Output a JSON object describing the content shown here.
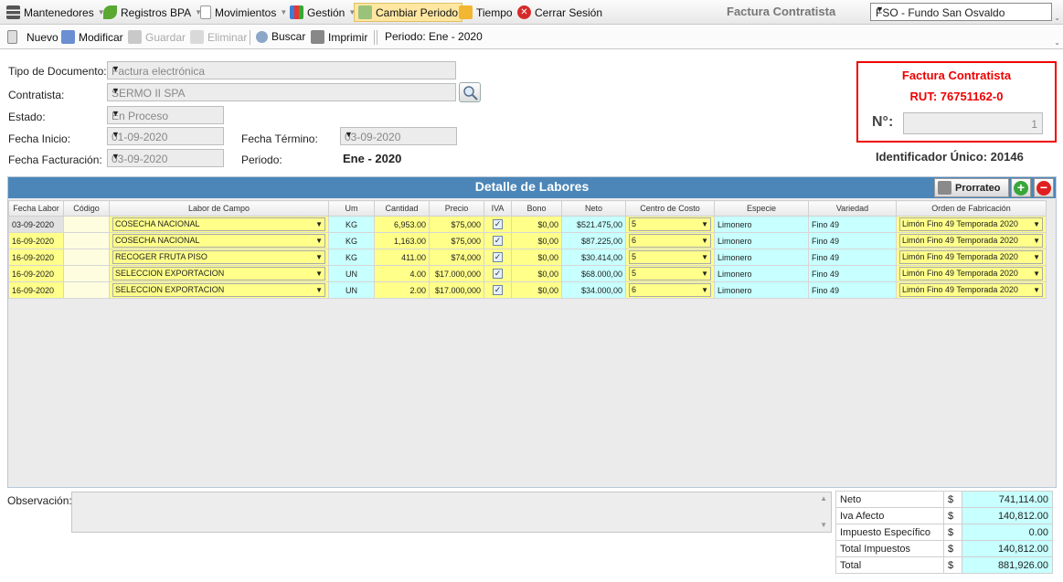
{
  "menu": {
    "items": [
      {
        "label": "Mantenedores",
        "icon": "table-icon"
      },
      {
        "label": "Registros BPA",
        "icon": "leaf-icon"
      },
      {
        "label": "Movimientos",
        "icon": "document-icon"
      },
      {
        "label": "Gestión",
        "icon": "chart-icon"
      },
      {
        "label": "Cambiar Periodo",
        "icon": "calendar-refresh-icon"
      },
      {
        "label": "Tiempo",
        "icon": "clock-icon"
      },
      {
        "label": "Cerrar Sesión",
        "icon": "close-circle-icon"
      }
    ],
    "title": "Factura Contratista",
    "fundo": "FSO - Fundo San Osvaldo"
  },
  "toolbar": {
    "nuevo": "Nuevo",
    "modificar": "Modificar",
    "guardar": "Guardar",
    "eliminar": "Eliminar",
    "buscar": "Buscar",
    "imprimir": "Imprimir",
    "periodo": "Periodo: Ene - 2020"
  },
  "form": {
    "tipo_doc_label": "Tipo de Documento:",
    "tipo_doc": "Factura electrónica",
    "contratista_label": "Contratista:",
    "contratista": "SERMO II SPA",
    "estado_label": "Estado:",
    "estado": "En Proceso",
    "fecha_inicio_label": "Fecha Inicio:",
    "fecha_inicio": "01-09-2020",
    "fecha_termino_label": "Fecha Término:",
    "fecha_termino": "03-09-2020",
    "fecha_fact_label": "Fecha Facturación:",
    "fecha_fact": "03-09-2020",
    "periodo_label": "Periodo:",
    "periodo": "Ene - 2020"
  },
  "invoice": {
    "title": "Factura Contratista",
    "rut": "RUT: 76751162-0",
    "num_label": "N°:",
    "num": "1",
    "uid": "Identificador Único: 20146"
  },
  "grid": {
    "title": "Detalle de Labores",
    "prorrateo": "Prorrateo",
    "columns": [
      "Fecha Labor",
      "Código",
      "Labor de Campo",
      "Um",
      "Cantidad",
      "Precio",
      "IVA",
      "Bono",
      "Neto",
      "Centro de Costo",
      "Especie",
      "Variedad",
      "Orden de Fabricación"
    ],
    "rows": [
      {
        "fecha": "03-09-2020",
        "codigo": "",
        "labor": "COSECHA NACIONAL",
        "um": "KG",
        "cantidad": "6,953.00",
        "precio": "$75,000",
        "iva": true,
        "bono": "$0,00",
        "neto": "$521.475,00",
        "centro": "5",
        "especie": "Limonero",
        "variedad": "Fino 49",
        "orden": "Limón Fino 49 Temporada 2020"
      },
      {
        "fecha": "16-09-2020",
        "codigo": "",
        "labor": "COSECHA NACIONAL",
        "um": "KG",
        "cantidad": "1,163.00",
        "precio": "$75,000",
        "iva": true,
        "bono": "$0,00",
        "neto": "$87.225,00",
        "centro": "6",
        "especie": "Limonero",
        "variedad": "Fino 49",
        "orden": "Limón Fino 49 Temporada 2020"
      },
      {
        "fecha": "16-09-2020",
        "codigo": "",
        "labor": "RECOGER FRUTA PISO",
        "um": "KG",
        "cantidad": "411.00",
        "precio": "$74,000",
        "iva": true,
        "bono": "$0,00",
        "neto": "$30.414,00",
        "centro": "5",
        "especie": "Limonero",
        "variedad": "Fino 49",
        "orden": "Limón Fino 49 Temporada 2020"
      },
      {
        "fecha": "16-09-2020",
        "codigo": "",
        "labor": "SELECCION EXPORTACION",
        "um": "UN",
        "cantidad": "4.00",
        "precio": "$17.000,000",
        "iva": true,
        "bono": "$0,00",
        "neto": "$68.000,00",
        "centro": "5",
        "especie": "Limonero",
        "variedad": "Fino 49",
        "orden": "Limón Fino 49 Temporada 2020"
      },
      {
        "fecha": "16-09-2020",
        "codigo": "",
        "labor": "SELECCION EXPORTACION",
        "um": "UN",
        "cantidad": "2.00",
        "precio": "$17.000,000",
        "iva": true,
        "bono": "$0,00",
        "neto": "$34.000,00",
        "centro": "6",
        "especie": "Limonero",
        "variedad": "Fino 49",
        "orden": "Limón Fino 49 Temporada 2020"
      }
    ]
  },
  "observacion_label": "Observación:",
  "totals": [
    {
      "label": "Neto",
      "cur": "$",
      "value": "741,114.00"
    },
    {
      "label": "Iva Afecto",
      "cur": "$",
      "value": "140,812.00"
    },
    {
      "label": "Impuesto Específico",
      "cur": "$",
      "value": "0.00"
    },
    {
      "label": "Total Impuestos",
      "cur": "$",
      "value": "140,812.00"
    },
    {
      "label": "Total",
      "cur": "$",
      "value": "881,926.00"
    }
  ],
  "colors": {
    "accent": "#4c86b8",
    "alert": "#ee0000",
    "yellow_cell": "#ffff8a",
    "cyan_cell": "#c8ffff"
  }
}
